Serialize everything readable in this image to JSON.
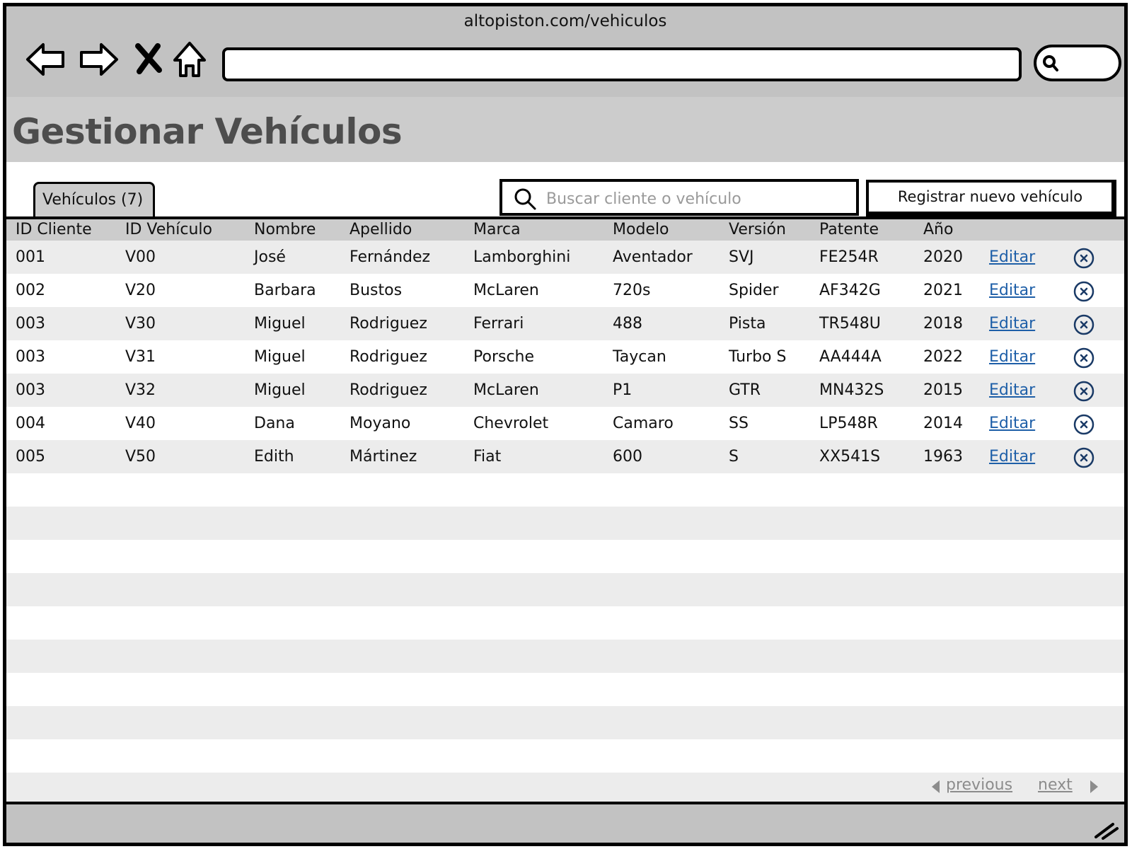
{
  "browser": {
    "url": "altopiston.com/vehiculos",
    "address_value": ""
  },
  "page": {
    "title": "Gestionar Vehículos"
  },
  "tabs": [
    {
      "label": "Vehículos (7)"
    }
  ],
  "search": {
    "placeholder": "Buscar cliente o vehículo",
    "value": ""
  },
  "actions": {
    "register_label": "Registrar nuevo vehículo"
  },
  "table": {
    "columns": [
      "ID Cliente",
      "ID Vehículo",
      "Nombre",
      "Apellido",
      "Marca",
      "Modelo",
      "Versión",
      "Patente",
      "Año"
    ],
    "rows": [
      [
        "001",
        "V00",
        "José",
        "Fernández",
        "Lamborghini",
        "Aventador",
        "SVJ",
        "FE254R",
        "2020"
      ],
      [
        "002",
        "V20",
        "Barbara",
        "Bustos",
        "McLaren",
        "720s",
        "Spider",
        "AF342G",
        "2021"
      ],
      [
        "003",
        "V30",
        "Miguel",
        "Rodriguez",
        "Ferrari",
        "488",
        "Pista",
        "TR548U",
        "2018"
      ],
      [
        "003",
        "V31",
        "Miguel",
        "Rodriguez",
        "Porsche",
        "Taycan",
        "Turbo S",
        "AA444A",
        "2022"
      ],
      [
        "003",
        "V32",
        "Miguel",
        "Rodriguez",
        "McLaren",
        "P1",
        "GTR",
        "MN432S",
        "2015"
      ],
      [
        "004",
        "V40",
        "Dana",
        "Moyano",
        "Chevrolet",
        "Camaro",
        "SS",
        "LP548R",
        "2014"
      ],
      [
        "005",
        "V50",
        "Edith",
        "Mártinez",
        "Fiat",
        "600",
        "S",
        "XX541S",
        "1963"
      ]
    ],
    "edit_label": "Editar",
    "empty_rows": 10
  },
  "pagination": {
    "previous": "previous",
    "next": "next"
  },
  "colors": {
    "chrome": "#c2c2c2",
    "header": "#cccccc",
    "stripe": "#ececec",
    "link": "#1e5fa8",
    "delete_icon": "#1a3a66",
    "title_text": "#4d4d4d"
  },
  "icons": {
    "back": "back-arrow-icon",
    "forward": "forward-arrow-icon",
    "stop": "close-x-icon",
    "home": "home-icon",
    "search": "search-icon",
    "delete": "circle-x-icon",
    "resize": "resize-grip-icon"
  }
}
